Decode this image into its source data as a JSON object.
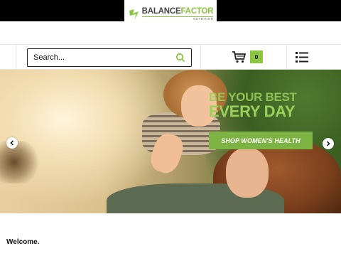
{
  "header": {
    "logo_word_1": "BALANCE",
    "logo_word_2": "FACTOR",
    "logo_sub": "NUTRITION"
  },
  "nav": {
    "search_placeholder": "Search...",
    "cart_count": "0"
  },
  "hero": {
    "headline_1": "BE YOUR BEST",
    "headline_2": "EVERY DAY",
    "cta_label": "SHOP WOMEN'S HEALTH"
  },
  "content": {
    "welcome_heading": "Welcome."
  },
  "colors": {
    "brand_green": "#8cc63f",
    "cta_green": "#7cb342",
    "topbar": "#000000"
  },
  "icons": [
    "logo-mark-icon",
    "search-icon",
    "cart-icon",
    "menu-list-icon",
    "chevron-left-icon",
    "chevron-right-icon"
  ]
}
